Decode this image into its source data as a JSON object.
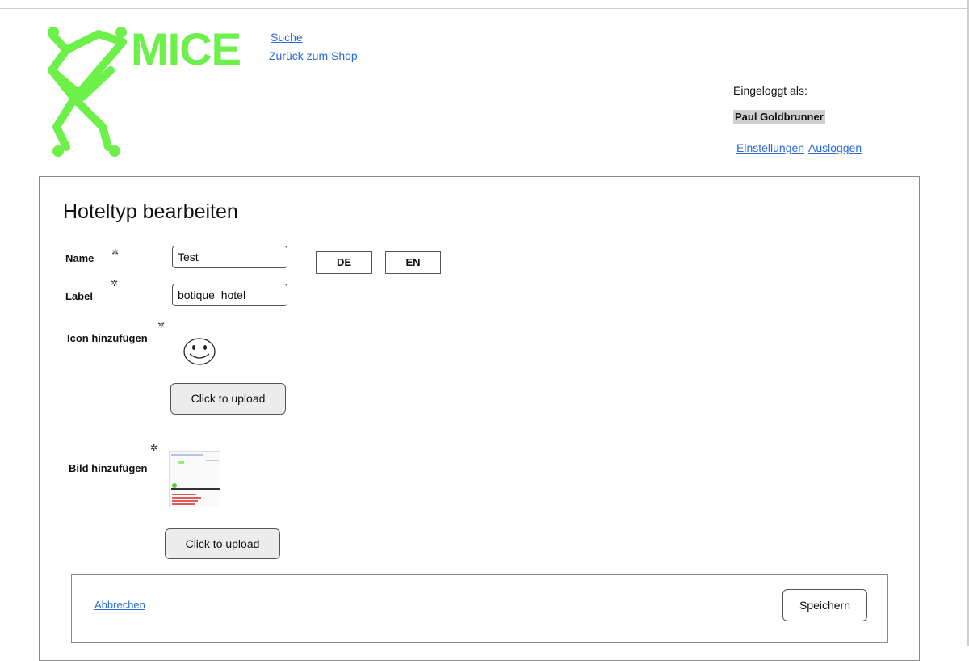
{
  "header": {
    "logo_text": "MICE",
    "nav": {
      "search": "Suche",
      "back_to_shop": "Zurück zum Shop"
    },
    "user": {
      "logged_in_label": "Eingeloggt als:",
      "name": "Paul Goldbrunner",
      "settings": "Einstellungen",
      "logout": "Ausloggen"
    }
  },
  "form": {
    "title": "Hoteltyp bearbeiten",
    "required_marker": "✲",
    "name": {
      "label": "Name",
      "value": "Test"
    },
    "languages": [
      "DE",
      "EN"
    ],
    "label": {
      "label": "Label",
      "value": "botique_hotel"
    },
    "icon": {
      "label": "Icon hinzufügen",
      "upload": "Click to upload"
    },
    "image": {
      "label": "Bild hinzufügen",
      "upload": "Click to upload"
    }
  },
  "footer": {
    "cancel": "Abbrechen",
    "save": "Speichern"
  },
  "colors": {
    "brand_green": "#6df04a",
    "link": "#2a6bd6"
  }
}
